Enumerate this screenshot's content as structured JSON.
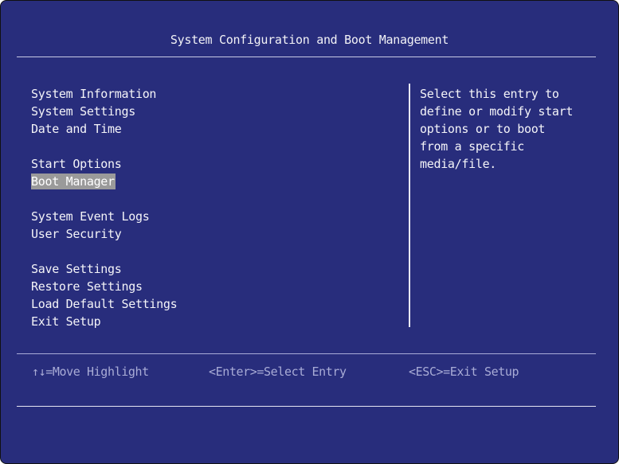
{
  "header": {
    "title": "System Configuration and Boot Management"
  },
  "menu": {
    "groups": [
      [
        "System Information",
        "System Settings",
        "Date and Time"
      ],
      [
        "Start Options",
        "Boot Manager"
      ],
      [
        "System Event Logs",
        "User Security"
      ],
      [
        "Save Settings",
        "Restore Settings",
        "Load Default Settings",
        "Exit Setup"
      ]
    ],
    "selected": "Boot Manager"
  },
  "help": {
    "lines": [
      "Select this entry to",
      "define or modify start",
      "options or to boot",
      "from a specific",
      "media/file."
    ]
  },
  "footer": {
    "hints": [
      {
        "key": "↑↓",
        "action": "=Move Highlight"
      },
      {
        "key": "<Enter>",
        "action": "=Select Entry"
      },
      {
        "key": "<ESC>",
        "action": "=Exit Setup"
      }
    ],
    "hint_text": [
      "↑↓=Move Highlight",
      "<Enter>=Select Entry",
      "<ESC>=Exit Setup"
    ]
  },
  "colors": {
    "background": "#282d7c",
    "text": "#f2f2f6",
    "highlight": "#9a9a9a",
    "footer_text": "#a9acd6"
  }
}
